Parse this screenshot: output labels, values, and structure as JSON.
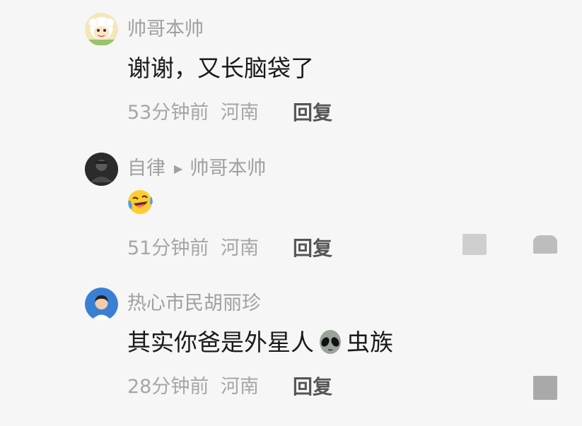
{
  "comments": [
    {
      "username": "帅哥本帅",
      "text": "谢谢，又长脑袋了",
      "time": "53分钟前",
      "location": "河南",
      "reply_label": "回复",
      "avatar": "sheep-cartoon-avatar"
    },
    {
      "username": "自律",
      "reply_to": "帅哥本帅",
      "emoji": "laughing-crying-emoji",
      "time": "51分钟前",
      "location": "河南",
      "reply_label": "回复",
      "avatar": "dark-photo-avatar"
    },
    {
      "username": "热心市民胡丽珍",
      "text_before": "其实你爸是外星人",
      "text_emoji": "alien-emoji",
      "text_after": "虫族",
      "time": "28分钟前",
      "location": "河南",
      "reply_label": "回复",
      "avatar": "person-photo-avatar"
    }
  ],
  "colors": {
    "background": "#f6f6f6",
    "username": "#a0a0a0",
    "body_text": "#1a1a1a",
    "meta": "#a6a6a6",
    "reply": "#555555"
  }
}
